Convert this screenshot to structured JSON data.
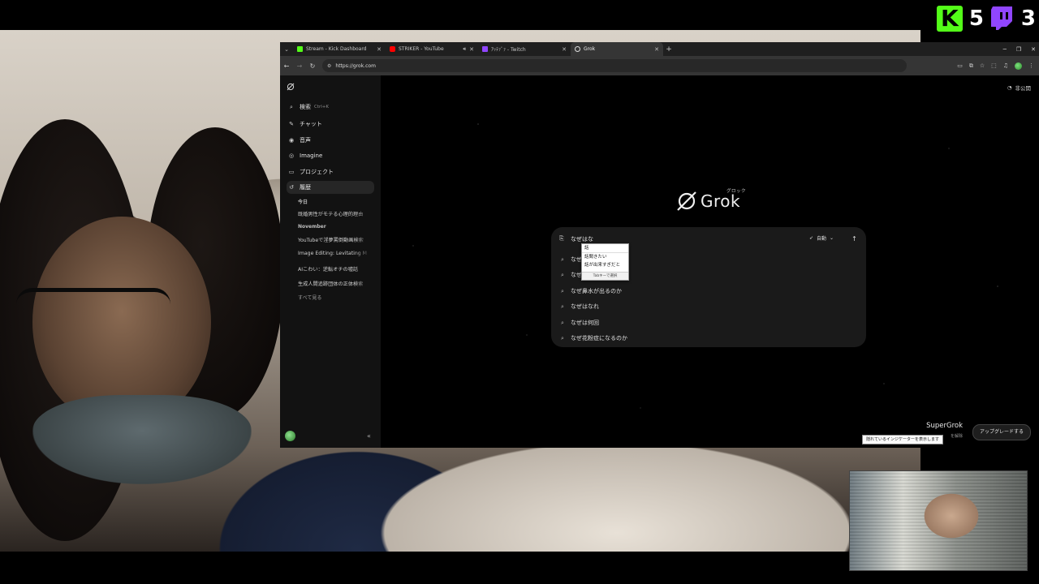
{
  "overlay": {
    "kick_count": "5",
    "twitch_count": "3",
    "kick_color": "#53fc18",
    "twitch_color": "#9146ff"
  },
  "browser": {
    "tabs": [
      {
        "title": "Stream - Kick Dashboard",
        "favicon_color": "#53fc18",
        "active": false
      },
      {
        "title": "STRIKER - YouTube",
        "favicon_color": "#ff0000",
        "active": false,
        "audio": true
      },
      {
        "title": "ｱｯﾃｧﾞｧ - Twitch",
        "favicon_color": "#9146ff",
        "active": false
      },
      {
        "title": "Grok",
        "favicon_color": "#dddddd",
        "active": true
      }
    ],
    "url": "https://grok.com"
  },
  "sidebar": {
    "search_label": "検索",
    "search_shortcut": "Ctrl+K",
    "items": [
      {
        "label": "チャット",
        "icon": "edit-icon"
      },
      {
        "label": "音声",
        "icon": "voice-icon"
      },
      {
        "label": "Imagine",
        "icon": "imagine-icon"
      },
      {
        "label": "プロジェクト",
        "icon": "folder-icon"
      },
      {
        "label": "履歴",
        "icon": "history-icon"
      }
    ],
    "history": {
      "groups": [
        {
          "label": "今日",
          "items": [
            "既婚男性がモテる心理的理由"
          ]
        },
        {
          "label": "November",
          "items": [
            "YouTubeで淫夢罵倒動画検索",
            "Image Editing: Levitating M",
            "AIこわい：逆転オチの嘘話",
            "生成人間追跡団体の正体検索"
          ]
        }
      ],
      "see_all": "すべて見る"
    }
  },
  "main": {
    "private_label": "非公開",
    "logo_text": "Grok",
    "logo_kana": "グロック",
    "search": {
      "value": "なぜはな",
      "mode": "自動",
      "suggestions": [
        "なぜは のか 君は今",
        "なぜ",
        "なぜ鼻水が出るのか",
        "なぜはなれ",
        "なぜは何回",
        "なぜ花粉症になるのか"
      ]
    },
    "ime": {
      "candidates": [
        "話",
        "話聞きたい",
        "話が出来すぎだと"
      ],
      "footer": "Tabキーで選択"
    },
    "supergrok": {
      "title": "SuperGrok",
      "subtitle": "を解除",
      "upgrade": "アップグレードする",
      "tooltip": "隠れているインジケーターを表示します"
    }
  }
}
